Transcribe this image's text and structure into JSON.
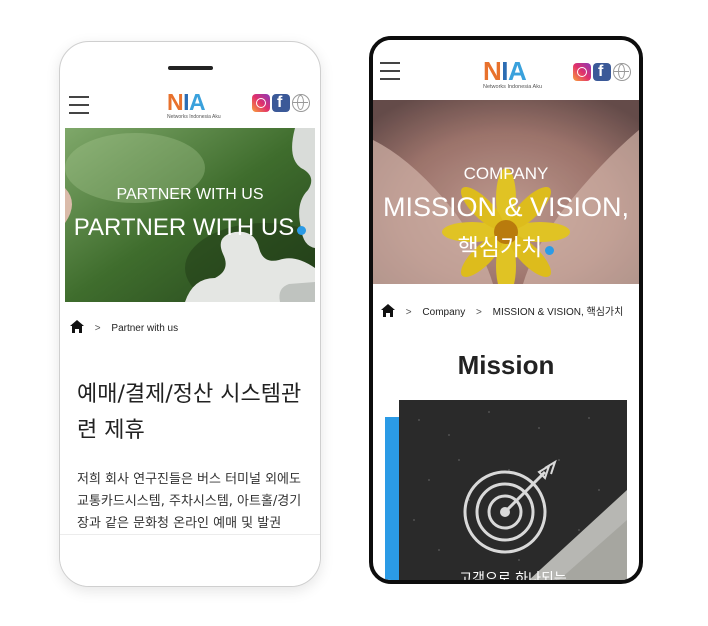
{
  "left_phone": {
    "header": {
      "logo_word": [
        "N",
        "I",
        "A"
      ],
      "logo_subtitle": "Networks Indonesia Aku",
      "social": [
        "instagram-icon",
        "facebook-icon",
        "globe-icon"
      ]
    },
    "hero": {
      "small_title": "PARTNER WITH US",
      "big_title": "PARTNER WITH US"
    },
    "breadcrumb": {
      "current": "Partner with us",
      "separator": ">"
    },
    "content": {
      "heading": "예매/결제/정산 시스템관련 제휴",
      "body": "저희 회사 연구진들은 버스 터미널 외에도 교통카드시스템, 주차시스템, 아트홀/경기장과 같은 문화청 온라인 예매 및 발권"
    }
  },
  "right_phone": {
    "header": {
      "logo_word": [
        "N",
        "I",
        "A"
      ],
      "logo_subtitle": "Networks Indonesia Aku",
      "social": [
        "instagram-icon",
        "facebook-icon",
        "globe-icon"
      ]
    },
    "hero": {
      "small_title": "COMPANY",
      "big_title_line1": "MISSION & VISION,",
      "big_title_line2": "핵심가치"
    },
    "breadcrumb": {
      "separator": ">",
      "level1": "Company",
      "current": "MISSION & VISION, 핵심가치"
    },
    "section": {
      "heading": "Mission",
      "card_caption": "고객으로 하나되는"
    }
  },
  "colors": {
    "accent_dot": "#2b9be6",
    "logo_orange": "#e8712c",
    "logo_blue": "#2b6cb3",
    "logo_lightblue": "#3aa1dc",
    "card_blue_bar": "#2b9be6"
  }
}
